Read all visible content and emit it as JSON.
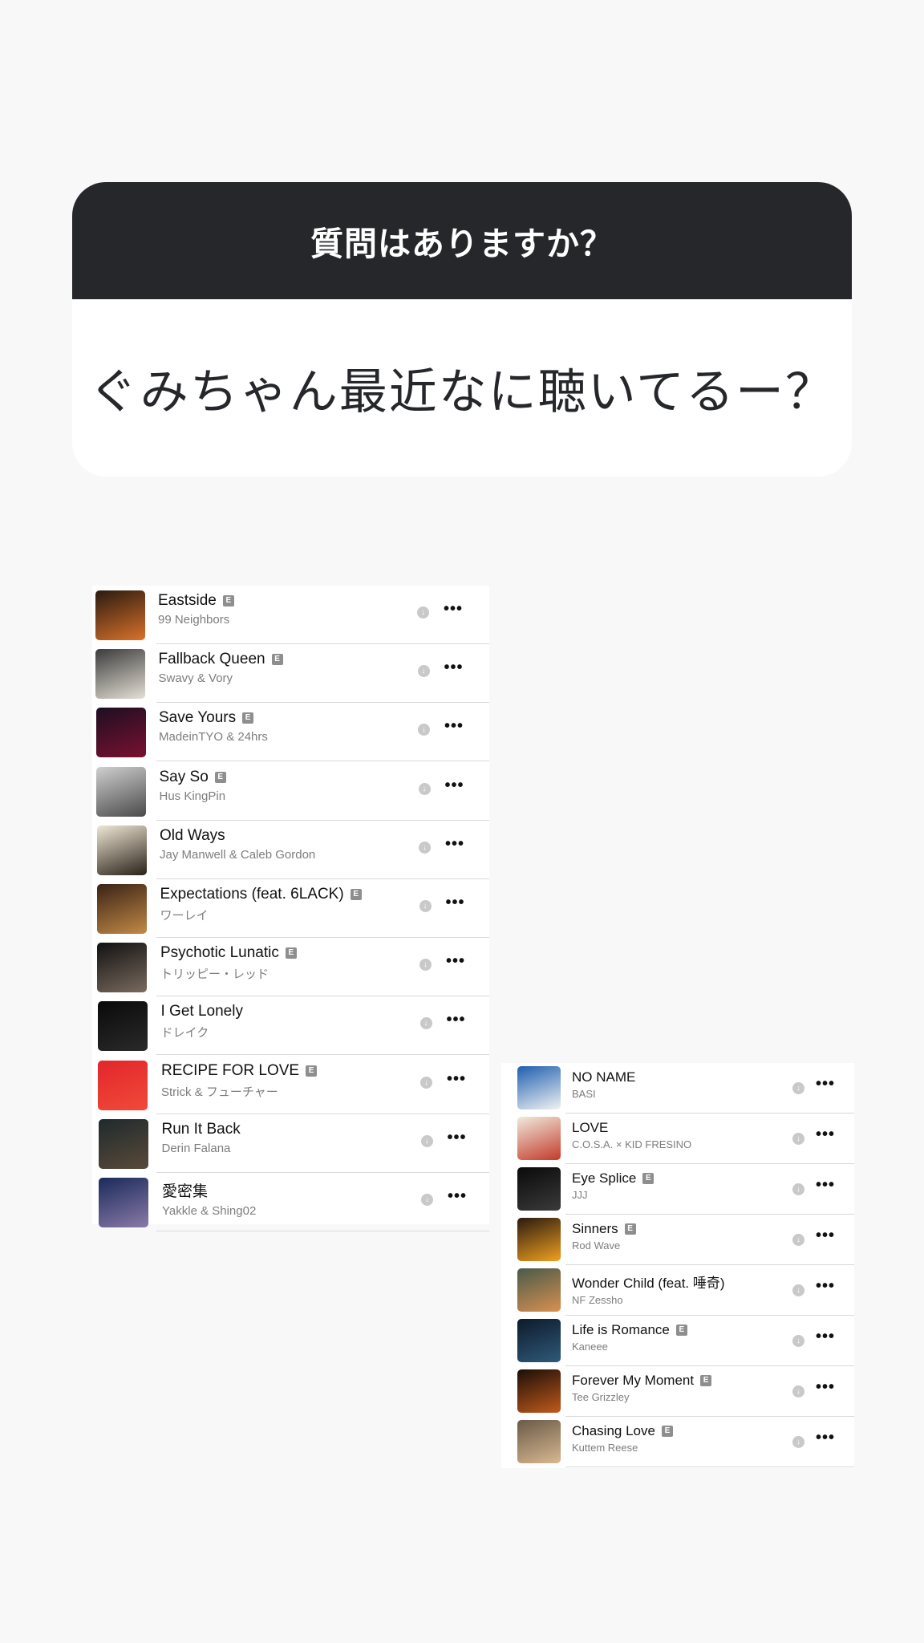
{
  "question": {
    "title": "質問はありますか？",
    "text": "ぐみちゃん最近なに聴いてるー？"
  },
  "list_left": [
    {
      "title": "Eastside",
      "artist": "99 Neighbors",
      "explicit": true,
      "art": [
        "#2a1a10",
        "#d9722a"
      ]
    },
    {
      "title": "Fallback Queen",
      "artist": "Swavy & Vory",
      "explicit": true,
      "art": [
        "#3b3b3b",
        "#e5e0d6"
      ]
    },
    {
      "title": "Save Yours",
      "artist": "MadeinTYO & 24hrs",
      "explicit": true,
      "art": [
        "#1d0f22",
        "#7a1030"
      ]
    },
    {
      "title": "Say So",
      "artist": "Hus KingPin",
      "explicit": true,
      "art": [
        "#cfcfcf",
        "#4a4a4a"
      ]
    },
    {
      "title": "Old Ways",
      "artist": "Jay Manwell & Caleb Gordon",
      "explicit": false,
      "art": [
        "#efe7d5",
        "#2a2118"
      ]
    },
    {
      "title": "Expectations (feat. 6LACK)",
      "artist": "ワーレイ",
      "explicit": true,
      "art": [
        "#3a2216",
        "#c28a46"
      ]
    },
    {
      "title": "Psychotic Lunatic",
      "artist": "トリッピー・レッド",
      "explicit": true,
      "art": [
        "#111111",
        "#7a6a5e"
      ]
    },
    {
      "title": "I Get Lonely",
      "artist": "ドレイク",
      "explicit": false,
      "art": [
        "#0a0a0a",
        "#2a2a2a"
      ]
    },
    {
      "title": "RECIPE FOR LOVE",
      "artist": "Strick & フューチャー",
      "explicit": true,
      "art": [
        "#e3262a",
        "#f04a3a"
      ]
    },
    {
      "title": "Run It Back",
      "artist": "Derin Falana",
      "explicit": false,
      "art": [
        "#1f2a2c",
        "#5a4a3a"
      ]
    },
    {
      "title": "愛密集",
      "artist": "Yakkle & Shing02",
      "explicit": false,
      "art": [
        "#1a2a5a",
        "#8a7aa8"
      ]
    }
  ],
  "list_right": [
    {
      "title": "NO NAME",
      "artist": "BASI",
      "explicit": false,
      "art": [
        "#1e5fb0",
        "#f2f2f2"
      ]
    },
    {
      "title": "LOVE",
      "artist": "C.O.S.A. × KID FRESINO",
      "explicit": false,
      "art": [
        "#efeadd",
        "#c43a2a"
      ]
    },
    {
      "title": "Eye Splice",
      "artist": "JJJ",
      "explicit": true,
      "art": [
        "#0a0a0a",
        "#3a3a3a"
      ]
    },
    {
      "title": "Sinners",
      "artist": "Rod Wave",
      "explicit": true,
      "art": [
        "#2a1a10",
        "#f0a020"
      ]
    },
    {
      "title": "Wonder Child (feat. 唾奇)",
      "artist": "NF Zessho",
      "explicit": false,
      "art": [
        "#4a5a4a",
        "#d89050"
      ]
    },
    {
      "title": "Life is Romance",
      "artist": "Kaneee",
      "explicit": true,
      "art": [
        "#0e1a2a",
        "#2e5a7a"
      ]
    },
    {
      "title": "Forever My Moment",
      "artist": "Tee Grizzley",
      "explicit": true,
      "art": [
        "#1a0e08",
        "#c25a1a"
      ]
    },
    {
      "title": "Chasing Love",
      "artist": "Kuttem Reese",
      "explicit": true,
      "art": [
        "#6a5a48",
        "#d8b890"
      ]
    }
  ],
  "icons": {
    "explicit_badge": "E",
    "download": "download-icon",
    "more": "•••"
  }
}
